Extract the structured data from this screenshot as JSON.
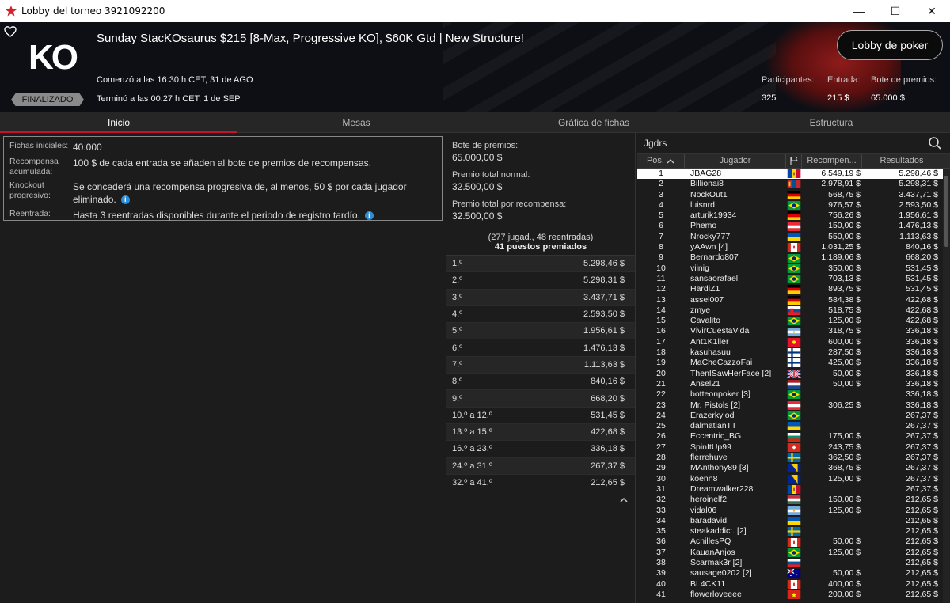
{
  "window": {
    "title": "Lobby del torneo 3921092200",
    "controls": {
      "minimize": "—",
      "maximize": "☐",
      "close": "✕"
    }
  },
  "header": {
    "logo": "KO",
    "status": "FINALIZADO",
    "title": "Sunday StacKOsaurus $215 [8-Max, Progressive KO], $60K Gtd | New Structure!",
    "started": "Comenzó a las 16:30 h CET, 31 de AGO",
    "ended": "Terminó a las 00:27 h CET, 1 de SEP",
    "lobby_button": "Lobby de poker",
    "stats": [
      {
        "label": "Participantes:",
        "value": "325"
      },
      {
        "label": "Entrada:",
        "value": "215 $"
      },
      {
        "label": "Bote de premios:",
        "value": "65.000 $"
      }
    ]
  },
  "tabs": [
    {
      "label": "Inicio"
    },
    {
      "label": "Mesas"
    },
    {
      "label": "Gráfica de fichas"
    },
    {
      "label": "Estructura"
    }
  ],
  "info": [
    {
      "k": "Fichas iniciales:",
      "v": "40.000",
      "icon": false
    },
    {
      "k": "Recompensa acumulada:",
      "v": "100 $ de cada entrada se añaden al bote de premios de recompensas.",
      "icon": false
    },
    {
      "k": "Knockout progresivo:",
      "v": "Se concederá una recompensa progresiva de, al menos, 50 $ por cada jugador eliminado.",
      "icon": true
    },
    {
      "k": "Reentrada:",
      "v": "Hasta 3 reentradas disponibles durante el periodo de registro tardío.",
      "icon": true
    }
  ],
  "prizepool": {
    "items": [
      {
        "label": "Bote de premios:",
        "value": "65.000,00 $"
      },
      {
        "label": "Premio total normal:",
        "value": "32.500,00 $"
      },
      {
        "label": "Premio total por recompensa:",
        "value": "32.500,00 $"
      }
    ],
    "summary1": "(277 jugad., 48 reentradas)",
    "summary2": "41 puestos premiados",
    "payouts": [
      {
        "p": "1.º",
        "a": "5.298,46 $"
      },
      {
        "p": "2.º",
        "a": "5.298,31 $"
      },
      {
        "p": "3.º",
        "a": "3.437,71 $"
      },
      {
        "p": "4.º",
        "a": "2.593,50 $"
      },
      {
        "p": "5.º",
        "a": "1.956,61 $"
      },
      {
        "p": "6.º",
        "a": "1.476,13 $"
      },
      {
        "p": "7.º",
        "a": "1.113,63 $"
      },
      {
        "p": "8.º",
        "a": "840,16 $"
      },
      {
        "p": "9.º",
        "a": "668,20 $"
      },
      {
        "p": "10.º a 12.º",
        "a": "531,45 $"
      },
      {
        "p": "13.º a 15.º",
        "a": "422,68 $"
      },
      {
        "p": "16.º a 23.º",
        "a": "336,18 $"
      },
      {
        "p": "24.º a 31.º",
        "a": "267,37 $"
      },
      {
        "p": "32.º a 41.º",
        "a": "212,65 $"
      }
    ]
  },
  "players": {
    "search_label": "Jgdrs",
    "headers": {
      "pos": "Pos.",
      "player": "Jugador",
      "bounty": "Recompen...",
      "results": "Resultados"
    },
    "rows": [
      {
        "pos": "1",
        "name": "JBAG28",
        "flag": "moldova",
        "bounty": "6.549,19 $",
        "result": "5.298,46 $"
      },
      {
        "pos": "2",
        "name": "Billionai8",
        "flag": "mongolia",
        "bounty": "2.978,91 $",
        "result": "5.298,31 $"
      },
      {
        "pos": "3",
        "name": "NockOut1",
        "flag": "germany",
        "bounty": "568,75 $",
        "result": "3.437,71 $"
      },
      {
        "pos": "4",
        "name": "luisnrd",
        "flag": "brazil",
        "bounty": "976,57 $",
        "result": "2.593,50 $"
      },
      {
        "pos": "5",
        "name": "arturik19934",
        "flag": "germany",
        "bounty": "756,26 $",
        "result": "1.956,61 $"
      },
      {
        "pos": "6",
        "name": "Phemo",
        "flag": "austria",
        "bounty": "150,00 $",
        "result": "1.476,13 $"
      },
      {
        "pos": "7",
        "name": "Nrocky777",
        "flag": "ukraine",
        "bounty": "550,00 $",
        "result": "1.113,63 $"
      },
      {
        "pos": "8",
        "name": "yAAwn [4]",
        "flag": "canada",
        "bounty": "1.031,25 $",
        "result": "840,16 $"
      },
      {
        "pos": "9",
        "name": "Bernardo807",
        "flag": "brazil",
        "bounty": "1.189,06 $",
        "result": "668,20 $"
      },
      {
        "pos": "10",
        "name": "viinig",
        "flag": "brazil",
        "bounty": "350,00 $",
        "result": "531,45 $"
      },
      {
        "pos": "11",
        "name": "sansaorafael",
        "flag": "brazil",
        "bounty": "703,13 $",
        "result": "531,45 $"
      },
      {
        "pos": "12",
        "name": "HardiZ1",
        "flag": "germany",
        "bounty": "893,75 $",
        "result": "531,45 $"
      },
      {
        "pos": "13",
        "name": "assel007",
        "flag": "germany",
        "bounty": "584,38 $",
        "result": "422,68 $"
      },
      {
        "pos": "14",
        "name": "zmye",
        "flag": "slovakia",
        "bounty": "518,75 $",
        "result": "422,68 $"
      },
      {
        "pos": "15",
        "name": "Cavalito",
        "flag": "brazil",
        "bounty": "125,00 $",
        "result": "422,68 $"
      },
      {
        "pos": "16",
        "name": "VivirCuestaVida",
        "flag": "argentina",
        "bounty": "318,75 $",
        "result": "336,18 $"
      },
      {
        "pos": "17",
        "name": "Ant1K1ller",
        "flag": "kyrgyzstan",
        "bounty": "600,00 $",
        "result": "336,18 $"
      },
      {
        "pos": "18",
        "name": "kasuhasuu",
        "flag": "finland",
        "bounty": "287,50 $",
        "result": "336,18 $"
      },
      {
        "pos": "19",
        "name": "MaCheCazzoFai",
        "flag": "finland",
        "bounty": "425,00 $",
        "result": "336,18 $"
      },
      {
        "pos": "20",
        "name": "ThenISawHerFace [2]",
        "flag": "uk",
        "bounty": "50,00 $",
        "result": "336,18 $"
      },
      {
        "pos": "21",
        "name": "Ansel21",
        "flag": "netherlands",
        "bounty": "50,00 $",
        "result": "336,18 $"
      },
      {
        "pos": "22",
        "name": "botteonpoker [3]",
        "flag": "brazil",
        "bounty": "",
        "result": "336,18 $"
      },
      {
        "pos": "23",
        "name": "Mr. Pistols [2]",
        "flag": "austria",
        "bounty": "306,25 $",
        "result": "336,18 $"
      },
      {
        "pos": "24",
        "name": "Erazerkylod",
        "flag": "brazil",
        "bounty": "",
        "result": "267,37 $"
      },
      {
        "pos": "25",
        "name": "dalmatianTT",
        "flag": "ukraine",
        "bounty": "",
        "result": "267,37 $"
      },
      {
        "pos": "26",
        "name": "Eccentric_BG",
        "flag": "bulgaria",
        "bounty": "175,00 $",
        "result": "267,37 $"
      },
      {
        "pos": "27",
        "name": "SpinItUp99",
        "flag": "switzerland",
        "bounty": "243,75 $",
        "result": "267,37 $"
      },
      {
        "pos": "28",
        "name": "flerrehuve",
        "flag": "sweden",
        "bounty": "362,50 $",
        "result": "267,37 $"
      },
      {
        "pos": "29",
        "name": "MAnthony89 [3]",
        "flag": "bosnia",
        "bounty": "368,75 $",
        "result": "267,37 $"
      },
      {
        "pos": "30",
        "name": "koenn8",
        "flag": "bosnia",
        "bounty": "125,00 $",
        "result": "267,37 $"
      },
      {
        "pos": "31",
        "name": "Dreamwalker228",
        "flag": "moldova",
        "bounty": "",
        "result": "267,37 $"
      },
      {
        "pos": "32",
        "name": "heroinelf2",
        "flag": "hungary",
        "bounty": "150,00 $",
        "result": "212,65 $"
      },
      {
        "pos": "33",
        "name": "vidal06",
        "flag": "argentina",
        "bounty": "125,00 $",
        "result": "212,65 $"
      },
      {
        "pos": "34",
        "name": "baradavid",
        "flag": "ukraine",
        "bounty": "",
        "result": "212,65 $"
      },
      {
        "pos": "35",
        "name": "steakaddict. [2]",
        "flag": "sweden",
        "bounty": "",
        "result": "212,65 $"
      },
      {
        "pos": "36",
        "name": "AchillesPQ",
        "flag": "canada",
        "bounty": "50,00 $",
        "result": "212,65 $"
      },
      {
        "pos": "37",
        "name": "KauanAnjos",
        "flag": "brazil",
        "bounty": "125,00 $",
        "result": "212,65 $"
      },
      {
        "pos": "38",
        "name": "Scarmak3r [2]",
        "flag": "slovenia",
        "bounty": "",
        "result": "212,65 $"
      },
      {
        "pos": "39",
        "name": "sausage0202 [2]",
        "flag": "australia",
        "bounty": "50,00 $",
        "result": "212,65 $"
      },
      {
        "pos": "40",
        "name": "BL4CK11",
        "flag": "canada",
        "bounty": "400,00 $",
        "result": "212,65 $"
      },
      {
        "pos": "41",
        "name": "flowerloveeee",
        "flag": "vietnam",
        "bounty": "200,00 $",
        "result": "212,65 $"
      }
    ]
  },
  "colors": {
    "accent": "#c8102e",
    "bg": "#1c1c1c",
    "header_bg": "#0d0f14",
    "info_icon": "#2a8fd8"
  }
}
